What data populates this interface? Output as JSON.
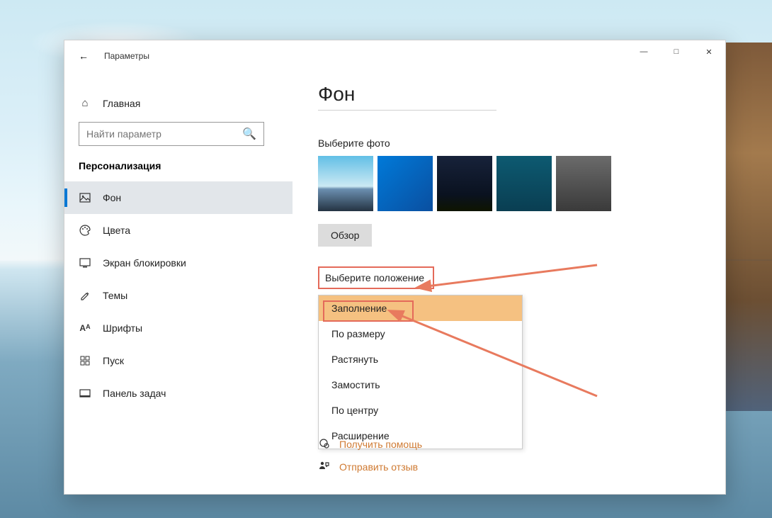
{
  "titlebar": {
    "minimize": "—",
    "maximize": "□",
    "close": "✕"
  },
  "sidebar": {
    "app_title": "Параметры",
    "home_label": "Главная",
    "search_placeholder": "Найти параметр",
    "category": "Персонализация",
    "items": [
      {
        "icon": "picture-icon",
        "glyph": "🖼",
        "label": "Фон"
      },
      {
        "icon": "palette-icon",
        "glyph": "🎨",
        "label": "Цвета"
      },
      {
        "icon": "lockscreen-icon",
        "glyph": "🖥",
        "label": "Экран блокировки"
      },
      {
        "icon": "themes-icon",
        "glyph": "✎",
        "label": "Темы"
      },
      {
        "icon": "fonts-icon",
        "glyph": "Aᴀ",
        "label": "Шрифты"
      },
      {
        "icon": "start-icon",
        "glyph": "▦",
        "label": "Пуск"
      },
      {
        "icon": "taskbar-icon",
        "glyph": "▭",
        "label": "Панель задач"
      }
    ],
    "active_index": 0
  },
  "main": {
    "title": "Фон",
    "choose_photo_label": "Выберите фото",
    "browse_label": "Обзор",
    "position_label": "Выберите положение",
    "position_options": [
      "Заполнение",
      "По размеру",
      "Растянуть",
      "Замостить",
      "По центру",
      "Расширение"
    ],
    "selected_position_index": 0,
    "help": {
      "get_help": "Получить помощь",
      "feedback": "Отправить отзыв"
    }
  },
  "colors": {
    "accent": "#0078d4",
    "annotation": "#e87a5e"
  }
}
